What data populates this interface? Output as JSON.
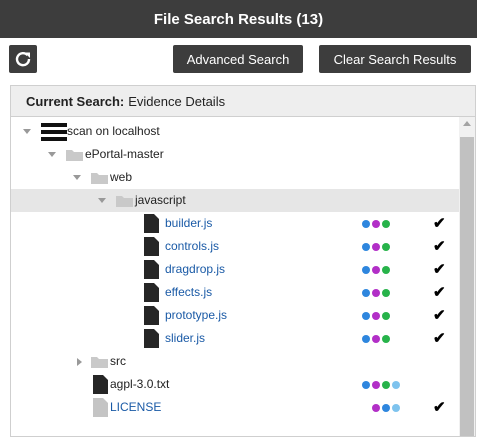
{
  "window": {
    "title": "File Search Results (13)"
  },
  "toolbar": {
    "advanced_search_label": "Advanced Search",
    "clear_results_label": "Clear Search Results"
  },
  "current_search": {
    "label": "Current Search:",
    "value": "Evidence Details"
  },
  "colors": {
    "blue": "#2e86de",
    "purple": "#b22fc7",
    "green": "#27b34a",
    "light_blue": "#7ec3ee",
    "link": "#1a5aa6"
  },
  "tree": [
    {
      "label": "scan on localhost",
      "icon": "server-icon",
      "expanded": true
    },
    {
      "label": "ePortal-master",
      "icon": "folder-icon",
      "expanded": true
    },
    {
      "label": "web",
      "icon": "folder-icon",
      "expanded": true
    },
    {
      "label": "javascript",
      "icon": "folder-icon",
      "expanded": true,
      "selected": true
    },
    {
      "label": "builder.js",
      "icon": "file-icon",
      "dots": [
        "blue",
        "purple",
        "green"
      ],
      "checked": true
    },
    {
      "label": "controls.js",
      "icon": "file-icon",
      "dots": [
        "blue",
        "purple",
        "green"
      ],
      "checked": true
    },
    {
      "label": "dragdrop.js",
      "icon": "file-icon",
      "dots": [
        "blue",
        "purple",
        "green"
      ],
      "checked": true
    },
    {
      "label": "effects.js",
      "icon": "file-icon",
      "dots": [
        "blue",
        "purple",
        "green"
      ],
      "checked": true
    },
    {
      "label": "prototype.js",
      "icon": "file-icon",
      "dots": [
        "blue",
        "purple",
        "green"
      ],
      "checked": true
    },
    {
      "label": "slider.js",
      "icon": "file-icon",
      "dots": [
        "blue",
        "purple",
        "green"
      ],
      "checked": true
    },
    {
      "label": "src",
      "icon": "folder-icon",
      "expanded": false
    },
    {
      "label": "agpl-3.0.txt",
      "icon": "file-icon",
      "dots": [
        "blue",
        "purple",
        "green",
        "light_blue"
      ],
      "checked": false
    },
    {
      "label": "LICENSE",
      "icon": "file-light-icon",
      "dots": [
        "purple",
        "blue",
        "light_blue"
      ],
      "checked": true
    }
  ]
}
